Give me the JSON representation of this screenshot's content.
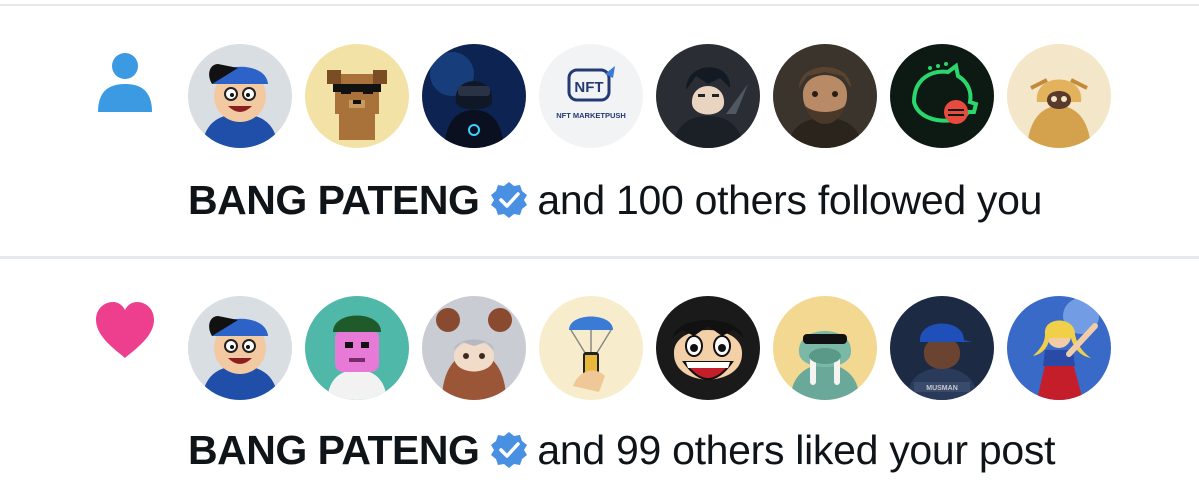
{
  "colors": {
    "follow_icon": "#3b9ae1",
    "like_icon": "#ee3f8f",
    "verified": "#4a90e2",
    "text": "#0f1419",
    "divider": "#e6e9eb"
  },
  "notifications": [
    {
      "type": "follow",
      "icon": "person-icon",
      "actor": "BANG PATENG",
      "verified": true,
      "action": "and 100 others followed you",
      "avatars": [
        {
          "name": "cartoon-boy-blue-cap"
        },
        {
          "name": "pixel-dog-sunglasses"
        },
        {
          "name": "hooded-figure-vr"
        },
        {
          "name": "nft-marketpush-logo",
          "logo_text": "NFT",
          "caption": "NFT MARKETPUSH"
        },
        {
          "name": "anime-man-dark"
        },
        {
          "name": "bearded-man-portrait"
        },
        {
          "name": "green-piggy-bank-logo"
        },
        {
          "name": "desert-masked-character"
        }
      ]
    },
    {
      "type": "like",
      "icon": "heart-icon",
      "actor": "BANG PATENG",
      "verified": true,
      "action": "and 99 others liked your post",
      "avatars": [
        {
          "name": "cartoon-boy-blue-cap"
        },
        {
          "name": "pink-ape-green-cap"
        },
        {
          "name": "bear-hood-girl"
        },
        {
          "name": "parachute-phone"
        },
        {
          "name": "anime-straw-hat-boy"
        },
        {
          "name": "walrus-sunglasses"
        },
        {
          "name": "man-blue-cap",
          "caption": "MUSMAN"
        },
        {
          "name": "superhero-woman"
        }
      ]
    }
  ]
}
